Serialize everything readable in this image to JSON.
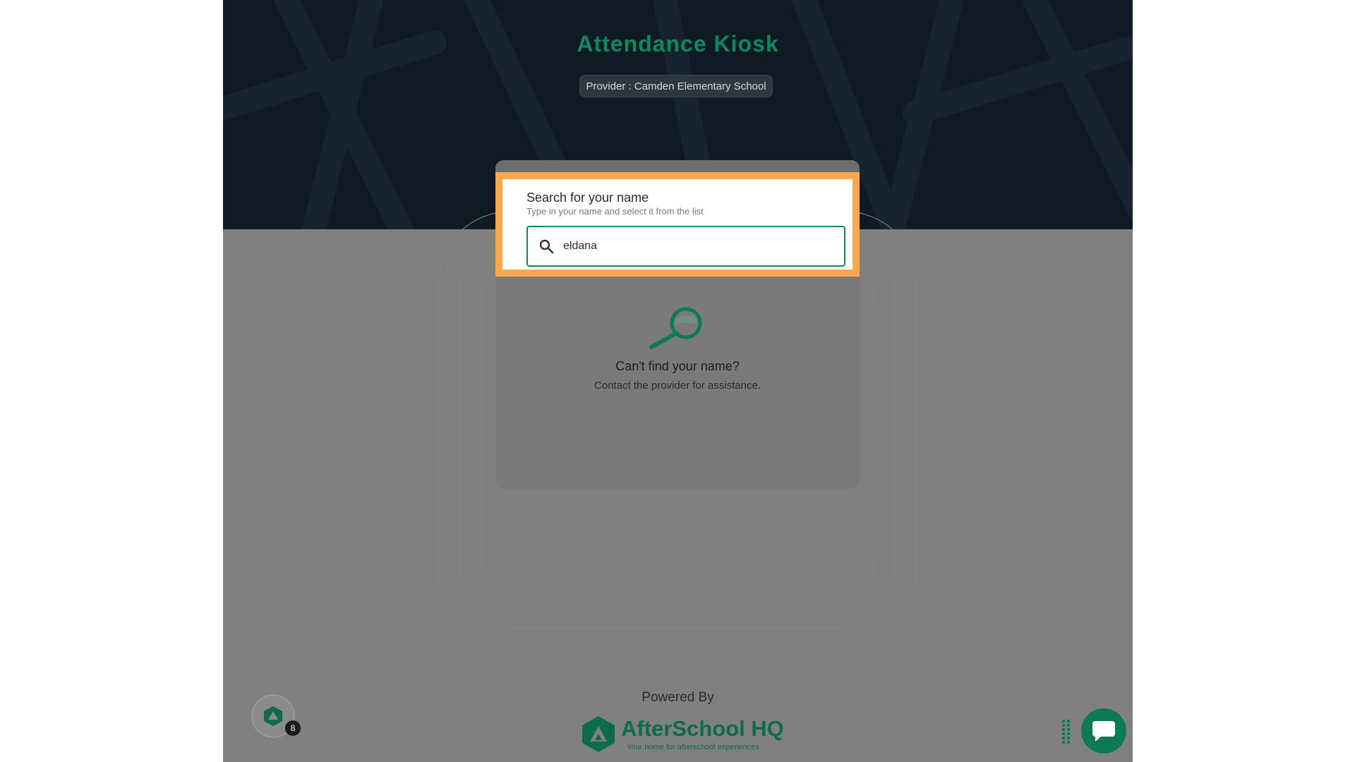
{
  "app": {
    "title": "Attendance Kiosk",
    "provider_label": "Provider : Camden Elementary School"
  },
  "search": {
    "heading": "Search for your name",
    "subheading": "Type in your name and select it from the list",
    "value": "eldana"
  },
  "empty_state": {
    "icon": "magnifier-icon",
    "title": "Can't find your name?",
    "message": "Contact the provider for assistance."
  },
  "footer": {
    "powered_by": "Powered By",
    "brand_name": "AfterSchool HQ",
    "brand_tagline": "Your home for afterschool experiences"
  },
  "widgets": {
    "help_badge_count": "8",
    "chat_icon": "chat-bubble-icon"
  },
  "colors": {
    "accent": "#0c8a5e",
    "highlight": "#f9a94c",
    "header_bg": "#0f1a24"
  }
}
